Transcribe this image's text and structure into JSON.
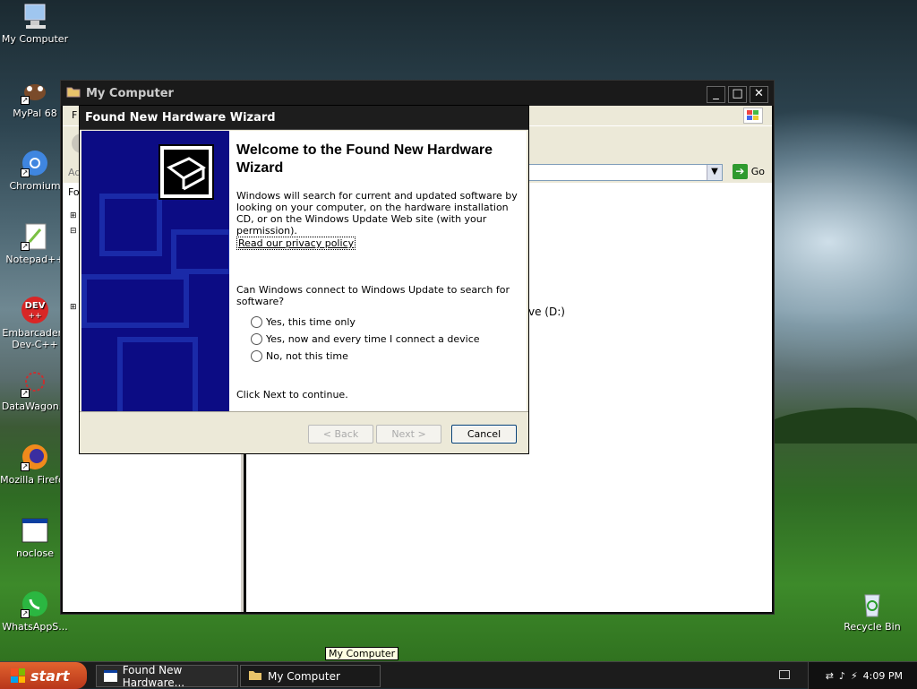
{
  "desktop": {
    "icons": [
      {
        "label": "My Computer",
        "icon": "my-computer-icon"
      },
      {
        "label": "MyPal 68",
        "icon": "mypal-icon"
      },
      {
        "label": "Chromium",
        "icon": "chromium-icon"
      },
      {
        "label": "Notepad++",
        "icon": "notepadpp-icon"
      },
      {
        "label": "Embarcadero Dev-C++",
        "line1": "Embarcadero",
        "line2": "Dev-C++",
        "icon": "devcpp-icon"
      },
      {
        "label": "DataWagon...",
        "icon": "datawagon-icon"
      },
      {
        "label": "Mozilla Firefox",
        "icon": "firefox-icon"
      },
      {
        "label": "noclose",
        "icon": "window-icon"
      },
      {
        "label": "WhatsAppS...",
        "icon": "whatsapp-icon"
      },
      {
        "label": "Recycle Bin",
        "icon": "recycle-bin-icon"
      }
    ]
  },
  "explorer": {
    "title": "My Computer",
    "menu_first": "F",
    "address_label": "Ad",
    "go_label": "Go",
    "left_label": "Fo",
    "drive_text": "ve (D:)",
    "controls": {
      "minimize": "_",
      "maximize": "□",
      "close": "✕"
    }
  },
  "wizard": {
    "title": "Found New Hardware Wizard",
    "heading": "Welcome to the Found New Hardware Wizard",
    "intro": "Windows will search for current and updated software by looking on your computer, on the hardware installation CD, or on the Windows Update Web site (with your permission).",
    "privacy_link": "Read our privacy policy",
    "question": "Can Windows connect to Windows Update to search for software?",
    "options": [
      "Yes, this time only",
      "Yes, now and every time I connect a device",
      "No, not this time"
    ],
    "continue_text": "Click Next to continue.",
    "buttons": {
      "back": "< Back",
      "next": "Next >",
      "cancel": "Cancel"
    }
  },
  "tooltip": "My Computer",
  "taskbar": {
    "start": "start",
    "tasks": [
      "Found New Hardware...",
      "My Computer"
    ],
    "clock": "4:09 PM"
  }
}
